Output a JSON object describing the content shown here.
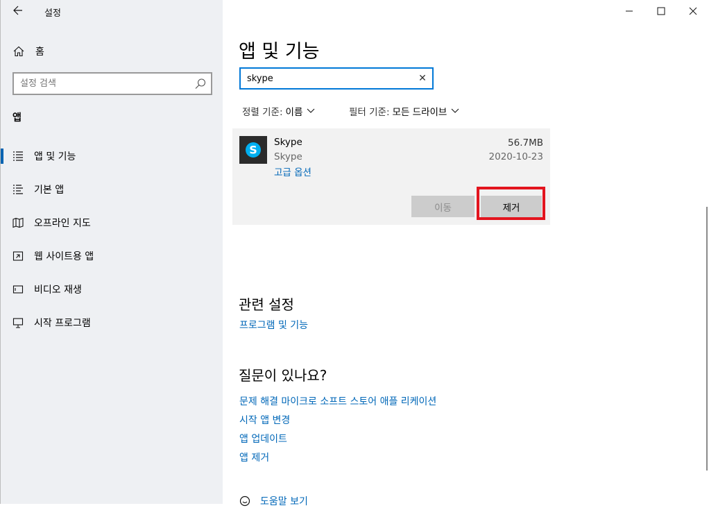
{
  "window": {
    "title": "설정",
    "minimize_icon": "minimize-icon",
    "maximize_icon": "maximize-icon",
    "close_icon": "close-icon"
  },
  "sidebar": {
    "home_label": "홈",
    "search_placeholder": "설정 검색",
    "section_label": "앱",
    "items": [
      {
        "label": "앱 및 기능",
        "icon": "apps-features-icon",
        "active": true
      },
      {
        "label": "기본 앱",
        "icon": "default-apps-icon",
        "active": false
      },
      {
        "label": "오프라인 지도",
        "icon": "offline-maps-icon",
        "active": false
      },
      {
        "label": "웹 사이트용 앱",
        "icon": "apps-for-websites-icon",
        "active": false
      },
      {
        "label": "비디오 재생",
        "icon": "video-playback-icon",
        "active": false
      },
      {
        "label": "시작 프로그램",
        "icon": "startup-icon",
        "active": false
      }
    ]
  },
  "main": {
    "title": "앱 및 기능",
    "filter_value": "skype",
    "sort_label": "정렬 기준:",
    "sort_value": "이름",
    "filter_by_label": "필터 기준:",
    "filter_by_value": "모든 드라이브",
    "app": {
      "name": "Skype",
      "publisher": "Skype",
      "advanced_options": "고급 옵션",
      "size": "56.7MB",
      "date": "2020-10-23",
      "move_label": "이동",
      "uninstall_label": "제거",
      "icon_letter": "S"
    },
    "related_title": "관련 설정",
    "related_link": "프로그램 및 기능",
    "questions_title": "질문이 있나요?",
    "question_links": [
      "문제 해결 마이크로 소프트 스토어 애플 리케이션",
      "시작 앱 변경",
      "앱 업데이트",
      "앱 제거"
    ],
    "help_label": "도움말 보기"
  },
  "colors": {
    "accent": "#0078d7",
    "link": "#0067b8",
    "highlight": "#e3141e",
    "skype_blue": "#00aff0"
  }
}
